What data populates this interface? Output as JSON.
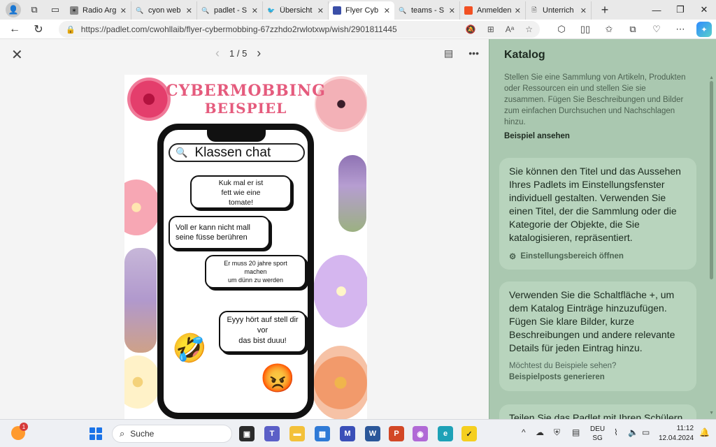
{
  "browser": {
    "tabs": [
      {
        "label": "Radio Arg",
        "fav_color": "#8a8a8a",
        "fav_glyph": "✶"
      },
      {
        "label": "cyon web",
        "fav_color": "#e9e9e9",
        "fav_glyph": "🔍"
      },
      {
        "label": "padlet - S",
        "fav_color": "#e9e9e9",
        "fav_glyph": "🔍"
      },
      {
        "label": "Übersicht",
        "fav_color": "#e9e9e9",
        "fav_glyph": "🐦"
      },
      {
        "label": "Flyer Cyb",
        "fav_color": "#3b4fa8",
        "fav_glyph": ""
      },
      {
        "label": "teams - S",
        "fav_color": "#e9e9e9",
        "fav_glyph": "🔍"
      },
      {
        "label": "Anmelden",
        "fav_color": "#f25022",
        "fav_glyph": ""
      },
      {
        "label": "Unterrich",
        "fav_color": "#e9e9e9",
        "fav_glyph": "🗎"
      }
    ],
    "active_tab_index": 4,
    "url": "https://padlet.com/cwohllaib/flyer-cybermobbing-67zzhdo2rwlotxwp/wish/2901811445"
  },
  "viewer": {
    "page_current": "1",
    "page_total": "5",
    "page_label": "1 / 5"
  },
  "poster": {
    "title_line1": "CYBERMOBBING",
    "title_line2": "BEISPIEL",
    "chat_title": "Klassen chat",
    "bubbles": [
      "Kuk mal er ist\nfett wie eine\ntomate!",
      "Voll er kann nicht mall\nseine füsse berühren",
      "Er muss 20 jahre sport\nmachen\num dünn zu werden",
      "Eyyy hört auf stell dir\nvor\ndas bist duuu!"
    ],
    "emoji_laugh": "🤣",
    "emoji_angry": "😡"
  },
  "panel": {
    "title": "Katalog",
    "description": "Stellen Sie eine Sammlung von Artikeln, Produkten oder Ressourcen ein und stellen Sie sie zusammen. Fügen Sie Beschreibungen und Bilder zum einfachen Durchsuchen und Nachschlagen hinzu.",
    "example_link": "Beispiel ansehen",
    "card1_text": "Sie können den Titel und das Aussehen Ihres Padlets im Einstellungsfenster individuell gestalten. Verwenden Sie einen Titel, der die Sammlung oder die Kategorie der Objekte, die Sie katalogisieren, repräsentiert.",
    "card1_action": "Einstellungsbereich öffnen",
    "card2_text": "Verwenden Sie die Schaltfläche +, um dem Katalog Einträge hinzuzufügen. Fügen Sie klare Bilder, kurze Beschreibungen und andere relevante Details für jeden Eintrag hinzu.",
    "card2_question": "Möchtest du Beispiele sehen?",
    "card2_action": "Beispielposts generieren",
    "card3_text": "Teilen Sie das Padlet mit Ihren Schülern"
  },
  "taskbar": {
    "weather_badge": "1",
    "search_label": "Suche",
    "lang_line1": "DEU",
    "lang_line2": "SG",
    "time": "11:12",
    "date": "12.04.2024"
  },
  "colors": {
    "panel_bg": "#aac8b0",
    "card_bg": "#b8d4bd",
    "poster_title": "#e55b7d"
  }
}
